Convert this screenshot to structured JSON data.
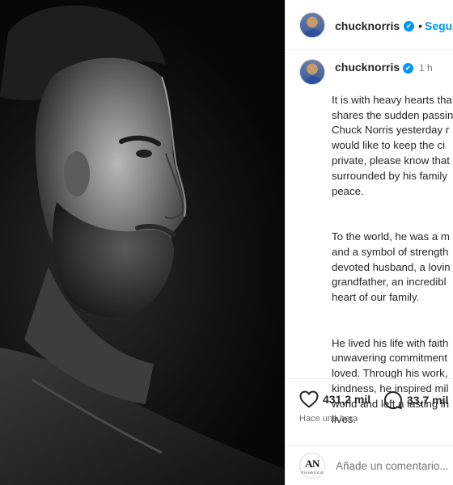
{
  "header": {
    "username": "chucknorris",
    "verified_mark": "✔",
    "separator": "•",
    "follow_label": "Seguin"
  },
  "caption": {
    "username": "chucknorris",
    "time": "1 h",
    "paragraphs": [
      "It is with heavy hearts tha\nshares the sudden passin\nChuck Norris yesterday r\nwould like to keep the ci\nprivate, please know that\nsurrounded by his family\npeace.",
      "To the world, he was a m\nand a symbol of strength\ndevoted husband, a lovin\ngrandfather, an incredibl\nheart of our family.",
      "He lived his life with faith\nunwavering commitment\nloved. Through his work,\nkindness, he inspired mil\nworld and left a lasting in\nlives."
    ]
  },
  "actions": {
    "like_icon": "heart-icon",
    "likes": "431,2 mil",
    "comment_icon": "comment-icon",
    "comments": "33,7 mil",
    "time_ago": "Hace una hora"
  },
  "comment_bar": {
    "avatar_text": "AN",
    "avatar_subtext": "RTA NEGOCIO",
    "placeholder": "Añade un comentario..."
  },
  "colors": {
    "accent": "#0095f6",
    "text": "#262626",
    "muted": "#737373",
    "divider": "#efefef"
  }
}
